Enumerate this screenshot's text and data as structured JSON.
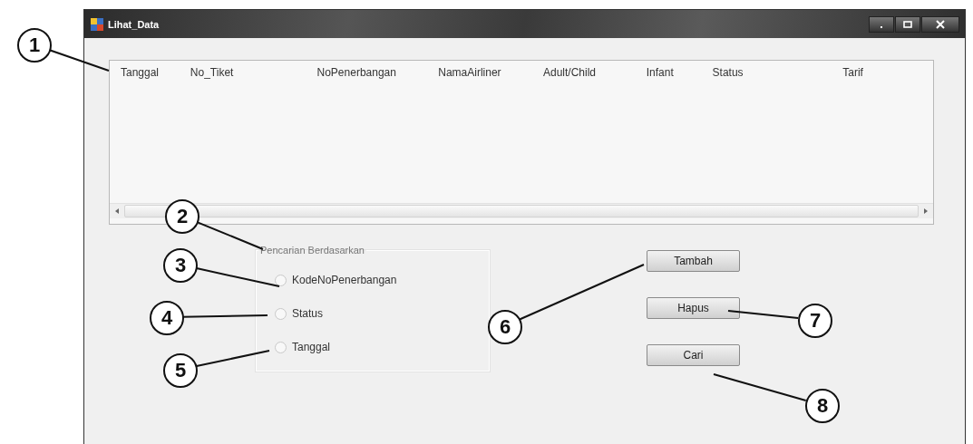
{
  "window": {
    "title": "Lihat_Data"
  },
  "table": {
    "columns": [
      "Tanggal",
      "No_Tiket",
      "NoPenerbangan",
      "NamaAirliner",
      "Adult/Child",
      "Infant",
      "Status",
      "Tarif"
    ]
  },
  "search_group": {
    "title": "Pencarian Berdasarkan",
    "options": [
      {
        "label": "KodeNoPenerbangan",
        "selected": false
      },
      {
        "label": "Status",
        "selected": false
      },
      {
        "label": "Tanggal",
        "selected": false
      }
    ]
  },
  "buttons": [
    "Tambah",
    "Hapus",
    "Cari"
  ],
  "callouts": [
    "1",
    "2",
    "3",
    "4",
    "5",
    "6",
    "7",
    "8"
  ]
}
